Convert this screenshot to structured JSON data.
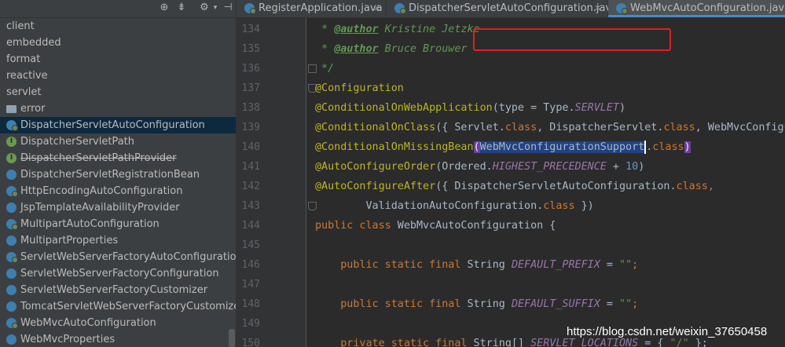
{
  "toolbar": {
    "icons": [
      "target-icon",
      "collapse-icon",
      "gear-icon",
      "hide-icon"
    ]
  },
  "tree": {
    "items": [
      {
        "label": "client",
        "kind": "pkg"
      },
      {
        "label": "embedded",
        "kind": "pkg"
      },
      {
        "label": "format",
        "kind": "pkg"
      },
      {
        "label": "reactive",
        "kind": "pkg"
      },
      {
        "label": "servlet",
        "kind": "pkg"
      },
      {
        "label": "error",
        "kind": "folder"
      },
      {
        "label": "DispatcherServletAutoConfiguration",
        "kind": "spring",
        "selected": true
      },
      {
        "label": "DispatcherServletPath",
        "kind": "interface"
      },
      {
        "label": "DispatcherServletPathProvider",
        "kind": "interface",
        "deprecated": true
      },
      {
        "label": "DispatcherServletRegistrationBean",
        "kind": "class"
      },
      {
        "label": "HttpEncodingAutoConfiguration",
        "kind": "spring"
      },
      {
        "label": "JspTemplateAvailabilityProvider",
        "kind": "class"
      },
      {
        "label": "MultipartAutoConfiguration",
        "kind": "spring"
      },
      {
        "label": "MultipartProperties",
        "kind": "class"
      },
      {
        "label": "ServletWebServerFactoryAutoConfiguration",
        "kind": "spring"
      },
      {
        "label": "ServletWebServerFactoryConfiguration",
        "kind": "class"
      },
      {
        "label": "ServletWebServerFactoryCustomizer",
        "kind": "class"
      },
      {
        "label": "TomcatServletWebServerFactoryCustomizer",
        "kind": "class"
      },
      {
        "label": "WebMvcAutoConfiguration",
        "kind": "spring"
      },
      {
        "label": "WebMvcProperties",
        "kind": "class"
      }
    ]
  },
  "tabs": [
    {
      "label": "RegisterApplication.java",
      "active": false
    },
    {
      "label": "DispatcherServletAutoConfiguration.java",
      "active": false
    },
    {
      "label": "WebMvcAutoConfiguration.java",
      "active": true
    }
  ],
  "editor": {
    "line_numbers": [
      "134",
      "135",
      "136",
      "137",
      "138",
      "139",
      "140",
      "141",
      "142",
      "143",
      "144",
      "145",
      "146",
      "147",
      "148",
      "149",
      "150"
    ],
    "lines": {
      "l134_pre": " * ",
      "l134_tag": "@author",
      "l134_txt": " Kristine Jetzke",
      "l135_pre": " * ",
      "l135_tag": "@author",
      "l135_txt": " Bruce Brouwer",
      "l136": " */",
      "l137": "@Configuration",
      "l138_a": "@ConditionalOnWebApplication",
      "l138_b": "(type = Type.",
      "l138_c": "SERVLET",
      "l138_d": ")",
      "l139_a": "@ConditionalOnClass",
      "l139_b": "({ Servlet.",
      "l139_c": "class",
      "l139_d": ", DispatcherServlet.",
      "l139_e": "class",
      "l139_f": ", WebMvcConfigu",
      "l140_a": "@ConditionalOnMissingBean",
      "l140_b": "(",
      "l140_c": "WebMvcConfigurationSupport",
      "l140_d": ".",
      "l140_e": "class",
      "l140_f": ")",
      "l141_a": "@AutoConfigureOrder",
      "l141_b": "(Ordered.",
      "l141_c": "HIGHEST_PRECEDENCE",
      "l141_d": " + ",
      "l141_e": "10",
      "l141_f": ")",
      "l142_a": "@AutoConfigureAfter",
      "l142_b": "({ DispatcherServletAutoConfiguration.",
      "l142_c": "class",
      "l142_d": ",",
      "l143_a": "        ValidationAutoConfiguration.",
      "l143_b": "class",
      "l143_c": " })",
      "l144_a": "public class",
      "l144_b": " WebMvcAutoConfiguration ",
      "l144_c": "{",
      "l146_a": "    public static final",
      "l146_b": " String ",
      "l146_c": "DEFAULT_PREFIX",
      "l146_d": " = ",
      "l146_e": "\"\"",
      "l146_f": ";",
      "l148_a": "    public static final",
      "l148_b": " String ",
      "l148_c": "DEFAULT_SUFFIX",
      "l148_d": " = ",
      "l148_e": "\"\"",
      "l148_f": ";",
      "l150_a": "    private static final",
      "l150_b": " String[] ",
      "l150_c": "SERVLET_LOCATIONS",
      "l150_d": " = { ",
      "l150_e": "\"/\"",
      "l150_f": " };"
    }
  },
  "watermark": "https://blog.csdn.net/weixin_37650458"
}
